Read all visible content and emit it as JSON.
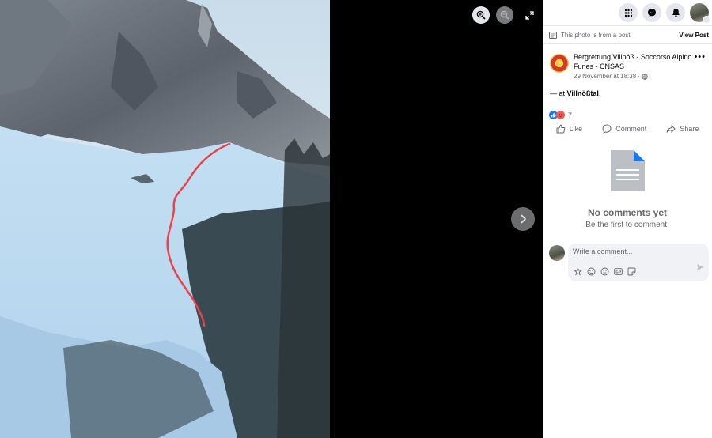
{
  "viewer": {
    "zoom_in_icon": "zoom-in-icon",
    "zoom_out_icon": "zoom-out-icon",
    "fullscreen_icon": "fullscreen-icon",
    "next_icon": "chevron-right-icon"
  },
  "topbar": {
    "menu_icon": "grid-menu-icon",
    "messenger_icon": "messenger-icon",
    "notifications_icon": "bell-icon"
  },
  "notice": {
    "text": "This photo is from a post.",
    "view_post": "View Post"
  },
  "post": {
    "author": "Bergrettung Villnöß - Soccorso Alpino Funes - CNSAS",
    "timestamp": "29 November at 18:38",
    "body_prefix": "— at ",
    "location": "Villnößtal",
    "body_suffix": ".",
    "reaction_count": "7",
    "like_label": "Like",
    "comment_label": "Comment",
    "share_label": "Share"
  },
  "comments": {
    "empty_title": "No comments yet",
    "empty_subtitle": "Be the first to comment.",
    "placeholder": "Write a comment..."
  },
  "colors": {
    "accent": "#1877f2",
    "route_line": "#e8434a",
    "reaction_angry": "#f0594c"
  }
}
